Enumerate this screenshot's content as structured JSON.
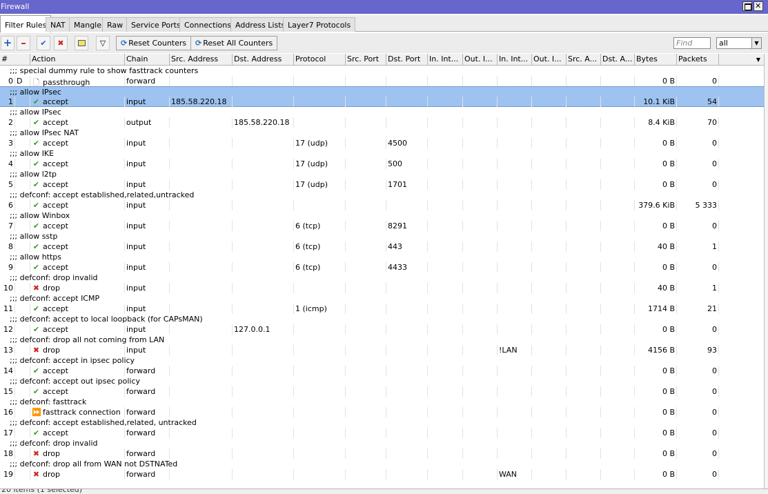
{
  "window": {
    "title": "Firewall"
  },
  "tabs": [
    "Filter Rules",
    "NAT",
    "Mangle",
    "Raw",
    "Service Ports",
    "Connections",
    "Address Lists",
    "Layer7 Protocols"
  ],
  "toolbar": {
    "reset_counters": "Reset Counters",
    "reset_all_counters": "Reset All Counters",
    "find_placeholder": "Find",
    "filter_value": "all"
  },
  "columns": [
    "#",
    "Action",
    "Chain",
    "Src. Address",
    "Dst. Address",
    "Protocol",
    "Src. Port",
    "Dst. Port",
    "In. Int...",
    "Out. I...",
    "In. Int...",
    "Out. I...",
    "Src. A...",
    "Dst. A...",
    "Bytes",
    "Packets"
  ],
  "rows": [
    {
      "comment": ";;; special dummy rule to show fasttrack counters",
      "num": "0",
      "flag": "D",
      "icon": "pass",
      "action": "passthrough",
      "chain": "forward",
      "src": "",
      "dst": "",
      "proto": "",
      "dport": "",
      "inlist": "",
      "bytes": "0 B",
      "packets": "0"
    },
    {
      "comment": ";;; allow IPsec",
      "num": "1",
      "flag": "",
      "icon": "accept",
      "action": "accept",
      "chain": "input",
      "src": "185.58.220.18",
      "dst": "",
      "proto": "",
      "dport": "",
      "inlist": "",
      "bytes": "10.1 KiB",
      "packets": "54",
      "selected": true
    },
    {
      "comment": ";;; allow IPsec",
      "num": "2",
      "flag": "",
      "icon": "accept",
      "action": "accept",
      "chain": "output",
      "src": "",
      "dst": "185.58.220.18",
      "proto": "",
      "dport": "",
      "inlist": "",
      "bytes": "8.4 KiB",
      "packets": "70"
    },
    {
      "comment": ";;; allow IPsec NAT",
      "num": "3",
      "flag": "",
      "icon": "accept",
      "action": "accept",
      "chain": "input",
      "src": "",
      "dst": "",
      "proto": "17 (udp)",
      "dport": "4500",
      "inlist": "",
      "bytes": "0 B",
      "packets": "0"
    },
    {
      "comment": ";;; allow IKE",
      "num": "4",
      "flag": "",
      "icon": "accept",
      "action": "accept",
      "chain": "input",
      "src": "",
      "dst": "",
      "proto": "17 (udp)",
      "dport": "500",
      "inlist": "",
      "bytes": "0 B",
      "packets": "0"
    },
    {
      "comment": ";;; allow l2tp",
      "num": "5",
      "flag": "",
      "icon": "accept",
      "action": "accept",
      "chain": "input",
      "src": "",
      "dst": "",
      "proto": "17 (udp)",
      "dport": "1701",
      "inlist": "",
      "bytes": "0 B",
      "packets": "0"
    },
    {
      "comment": ";;; defconf: accept established,related,untracked",
      "num": "6",
      "flag": "",
      "icon": "accept",
      "action": "accept",
      "chain": "input",
      "src": "",
      "dst": "",
      "proto": "",
      "dport": "",
      "inlist": "",
      "bytes": "379.6 KiB",
      "packets": "5 333"
    },
    {
      "comment": ";;; allow Winbox",
      "num": "7",
      "flag": "",
      "icon": "accept",
      "action": "accept",
      "chain": "input",
      "src": "",
      "dst": "",
      "proto": "6 (tcp)",
      "dport": "8291",
      "inlist": "",
      "bytes": "0 B",
      "packets": "0"
    },
    {
      "comment": ";;; allow sstp",
      "num": "8",
      "flag": "",
      "icon": "accept",
      "action": "accept",
      "chain": "input",
      "src": "",
      "dst": "",
      "proto": "6 (tcp)",
      "dport": "443",
      "inlist": "",
      "bytes": "40 B",
      "packets": "1"
    },
    {
      "comment": ";;; allow https",
      "num": "9",
      "flag": "",
      "icon": "accept",
      "action": "accept",
      "chain": "input",
      "src": "",
      "dst": "",
      "proto": "6 (tcp)",
      "dport": "4433",
      "inlist": "",
      "bytes": "0 B",
      "packets": "0"
    },
    {
      "comment": ";;; defconf: drop invalid",
      "num": "10",
      "flag": "",
      "icon": "drop",
      "action": "drop",
      "chain": "input",
      "src": "",
      "dst": "",
      "proto": "",
      "dport": "",
      "inlist": "",
      "bytes": "40 B",
      "packets": "1"
    },
    {
      "comment": ";;; defconf: accept ICMP",
      "num": "11",
      "flag": "",
      "icon": "accept",
      "action": "accept",
      "chain": "input",
      "src": "",
      "dst": "",
      "proto": "1 (icmp)",
      "dport": "",
      "inlist": "",
      "bytes": "1714 B",
      "packets": "21"
    },
    {
      "comment": ";;; defconf: accept to local loopback (for CAPsMAN)",
      "num": "12",
      "flag": "",
      "icon": "accept",
      "action": "accept",
      "chain": "input",
      "src": "",
      "dst": "127.0.0.1",
      "proto": "",
      "dport": "",
      "inlist": "",
      "bytes": "0 B",
      "packets": "0"
    },
    {
      "comment": ";;; defconf: drop all not coming from LAN",
      "num": "13",
      "flag": "",
      "icon": "drop",
      "action": "drop",
      "chain": "input",
      "src": "",
      "dst": "",
      "proto": "",
      "dport": "",
      "inlist": "!LAN",
      "bytes": "4156 B",
      "packets": "93"
    },
    {
      "comment": ";;; defconf: accept in ipsec policy",
      "num": "14",
      "flag": "",
      "icon": "accept",
      "action": "accept",
      "chain": "forward",
      "src": "",
      "dst": "",
      "proto": "",
      "dport": "",
      "inlist": "",
      "bytes": "0 B",
      "packets": "0"
    },
    {
      "comment": ";;; defconf: accept out ipsec policy",
      "num": "15",
      "flag": "",
      "icon": "accept",
      "action": "accept",
      "chain": "forward",
      "src": "",
      "dst": "",
      "proto": "",
      "dport": "",
      "inlist": "",
      "bytes": "0 B",
      "packets": "0"
    },
    {
      "comment": ";;; defconf: fasttrack",
      "num": "16",
      "flag": "",
      "icon": "fast",
      "action": "fasttrack connection",
      "chain": "forward",
      "src": "",
      "dst": "",
      "proto": "",
      "dport": "",
      "inlist": "",
      "bytes": "0 B",
      "packets": "0"
    },
    {
      "comment": ";;; defconf: accept established,related, untracked",
      "num": "17",
      "flag": "",
      "icon": "accept",
      "action": "accept",
      "chain": "forward",
      "src": "",
      "dst": "",
      "proto": "",
      "dport": "",
      "inlist": "",
      "bytes": "0 B",
      "packets": "0"
    },
    {
      "comment": ";;; defconf: drop invalid",
      "num": "18",
      "flag": "",
      "icon": "drop",
      "action": "drop",
      "chain": "forward",
      "src": "",
      "dst": "",
      "proto": "",
      "dport": "",
      "inlist": "",
      "bytes": "0 B",
      "packets": "0"
    },
    {
      "comment": ";;; defconf: drop all from WAN not DSTNATed",
      "num": "19",
      "flag": "",
      "icon": "drop",
      "action": "drop",
      "chain": "forward",
      "src": "",
      "dst": "",
      "proto": "",
      "dport": "",
      "inlist": "WAN",
      "bytes": "0 B",
      "packets": "0"
    }
  ],
  "status": "20 items (1 selected)"
}
